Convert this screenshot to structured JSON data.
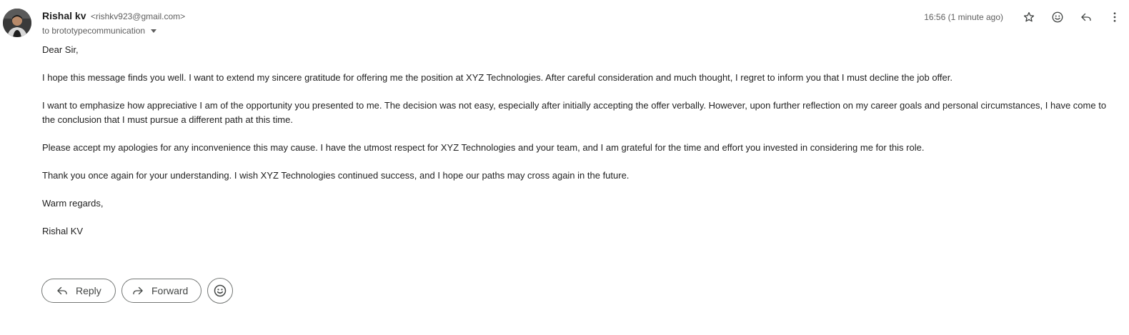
{
  "sender": {
    "name": "Rishal kv",
    "email": "<rishkv923@gmail.com>",
    "avatar_icon": "profile-photo"
  },
  "recipients": {
    "label": "to brototypecommunication"
  },
  "timestamp": "16:56 (1 minute ago)",
  "toolbar_icons": [
    "star-icon",
    "emoji-reaction-icon",
    "reply-icon",
    "more-vert-icon"
  ],
  "body": {
    "greeting": "Dear Sir,",
    "paragraphs": [
      "I hope this message finds you well. I want to extend my sincere gratitude for offering me the position at XYZ Technologies. After careful consideration and much thought, I regret to inform you that I must decline the job offer.",
      "I want to emphasize how appreciative I am of the opportunity you presented to me. The decision was not easy, especially after initially accepting the offer verbally. However, upon further reflection on my career goals and personal circumstances, I have come to the conclusion that I must pursue a different path at this time.",
      "Please accept my apologies for any inconvenience this may cause. I have the utmost respect for XYZ Technologies and your team, and I am grateful for the time and effort you invested in considering me for this role.",
      "Thank you once again for your understanding. I wish XYZ Technologies continued success, and I hope our paths may cross again in the future."
    ],
    "closing": "Warm regards,",
    "signature": "Rishal KV"
  },
  "actions": {
    "reply_label": "Reply",
    "forward_label": "Forward"
  },
  "colors": {
    "text": "#1f1f1f",
    "muted": "#5e5e5e",
    "border": "#747775"
  }
}
